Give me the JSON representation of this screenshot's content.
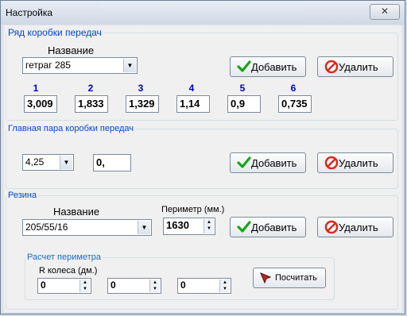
{
  "window": {
    "title": "Настройка",
    "close_glyph": "✕"
  },
  "gearbox": {
    "legend": "Ряд коробки передач",
    "name_label": "Название",
    "name_value": "гетраг 285",
    "add_label": "Добавить",
    "delete_label": "Удалить",
    "gears": [
      {
        "num": "1",
        "value": "3,009"
      },
      {
        "num": "2",
        "value": "1,833"
      },
      {
        "num": "3",
        "value": "1,329"
      },
      {
        "num": "4",
        "value": "1,14"
      },
      {
        "num": "5",
        "value": "0,9"
      },
      {
        "num": "6",
        "value": "0,735"
      }
    ]
  },
  "main_pair": {
    "legend": "Главная пара коробки передач",
    "combo_value": "4,25",
    "text_value": "0,",
    "add_label": "Добавить",
    "delete_label": "Удалить"
  },
  "tires": {
    "legend": "Резина",
    "name_label": "Название",
    "name_value": "205/55/16",
    "perimeter_label": "Периметр (мм.)",
    "perimeter_value": "1630",
    "add_label": "Добавить",
    "delete_label": "Удалить"
  },
  "perimeter_calc": {
    "legend": "Расчет периметра",
    "radius_label": "R колеса (дм.)",
    "values": [
      "0",
      "0",
      "0"
    ],
    "calc_label": "Посчитать"
  },
  "icons": {
    "add": "green-checkmark-icon",
    "delete": "red-no-sign-icon",
    "calc": "cursor-arrow-icon"
  },
  "colors": {
    "legend_text": "#0046d5",
    "gear_numbers": "#0000cc",
    "accent_green": "#1aa41a",
    "accent_red": "#d8281f"
  }
}
